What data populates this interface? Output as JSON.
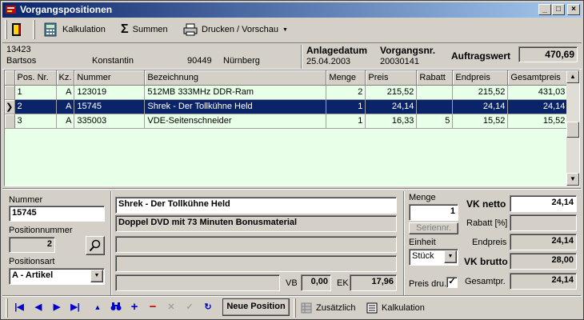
{
  "window": {
    "title": "Vorgangspositionen",
    "min": "_",
    "max": "□",
    "close": "×"
  },
  "toolbar": {
    "kalkulation": "Kalkulation",
    "summen": "Summen",
    "drucken": "Drucken / Vorschau"
  },
  "customer": {
    "number": "13423",
    "lastname": "Bartsos",
    "firstname": "Konstantin",
    "zip": "90449",
    "city": "Nürnberg"
  },
  "order": {
    "date_label": "Anlagedatum",
    "date": "25.04.2003",
    "nr_label": "Vorgangsnr.",
    "nr": "20030141",
    "value_label": "Auftragswert",
    "value": "470,69"
  },
  "grid": {
    "headers": [
      "Pos. Nr.",
      "Kz.",
      "Nummer",
      "Bezeichnung",
      "Menge",
      "Preis",
      "Rabatt",
      "Endpreis",
      "Gesamtpreis"
    ],
    "rows": [
      [
        "1",
        "A",
        "123019",
        "512MB 333MHz DDR-Ram",
        "2",
        "215,52",
        "",
        "215,52",
        "431,03"
      ],
      [
        "2",
        "A",
        "15745",
        "Shrek - Der Tollkühne Held",
        "1",
        "24,14",
        "",
        "24,14",
        "24,14"
      ],
      [
        "3",
        "A",
        "335003",
        "VDE-Seitenschneider",
        "1",
        "16,33",
        "5",
        "15,52",
        "15,52"
      ]
    ],
    "selected_row": 1
  },
  "detail": {
    "nummer_label": "Nummer",
    "nummer": "15745",
    "posnr_label": "Positionnummer",
    "posnr": "2",
    "posart_label": "Positionsart",
    "posart": "A - Artikel",
    "line1": "Shrek - Der Tollkühne Held",
    "line2": "Doppel DVD mit 73 Minuten Bonusmaterial",
    "vb_label": "VB",
    "vb": "0,00",
    "ek_label": "EK",
    "ek": "17,96",
    "menge_label": "Menge",
    "menge": "1",
    "serien_label": "Seriennr.",
    "einheit_label": "Einheit",
    "einheit": "Stück",
    "preisdru_label": "Preis dru.",
    "preisdru_checked": true,
    "vknetto_label": "VK netto",
    "vknetto": "24,14",
    "rabatt_label": "Rabatt [%]",
    "rabatt": "",
    "endpreis_label": "Endpreis",
    "endpreis": "24,14",
    "vkbrutto_label": "VK brutto",
    "vkbrutto": "28,00",
    "gesamtpr_label": "Gesamtpr.",
    "gesamtpr": "24,14"
  },
  "bottombar": {
    "neue_position": "Neue Position",
    "zusaetzlich": "Zusätzlich",
    "kalkulation": "Kalkulation"
  },
  "colors": {
    "title_start": "#0a246a",
    "title_end": "#a6caf0",
    "grid_bg": "#e8ffe8",
    "selection": "#0a246a",
    "nav_blue": "#0000cc",
    "nav_red": "#cc0000"
  }
}
